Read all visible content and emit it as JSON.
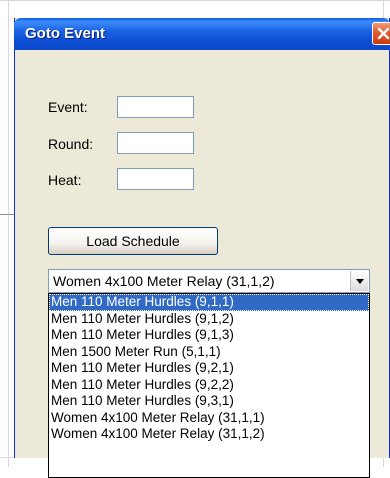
{
  "window": {
    "title": "Goto Event"
  },
  "form": {
    "event_label": "Event:",
    "event_value": "",
    "round_label": "Round:",
    "round_value": "",
    "heat_label": "Heat:",
    "heat_value": ""
  },
  "load_button_label": "Load Schedule",
  "combo": {
    "selected_value": "Women 4x100 Meter Relay (31,1,2)",
    "highlighted_index": 0,
    "items": [
      "Men 110 Meter Hurdles (9,1,1)",
      "Men 110 Meter Hurdles (9,1,2)",
      "Men 110 Meter Hurdles (9,1,3)",
      "Men 1500 Meter Run (5,1,1)",
      "Men 110 Meter Hurdles (9,2,1)",
      "Men 110 Meter Hurdles (9,2,2)",
      "Men 110 Meter Hurdles (9,3,1)",
      "Women 4x100 Meter Relay (31,1,1)",
      "Women 4x100 Meter Relay (31,1,2)"
    ]
  },
  "colors": {
    "titlebar": "#0c4fd6",
    "close_button": "#e35b2c",
    "dialog_background": "#ece9d8",
    "selection": "#316ac5"
  },
  "icons": {
    "close": "close-icon",
    "dropdown": "chevron-down-icon"
  }
}
